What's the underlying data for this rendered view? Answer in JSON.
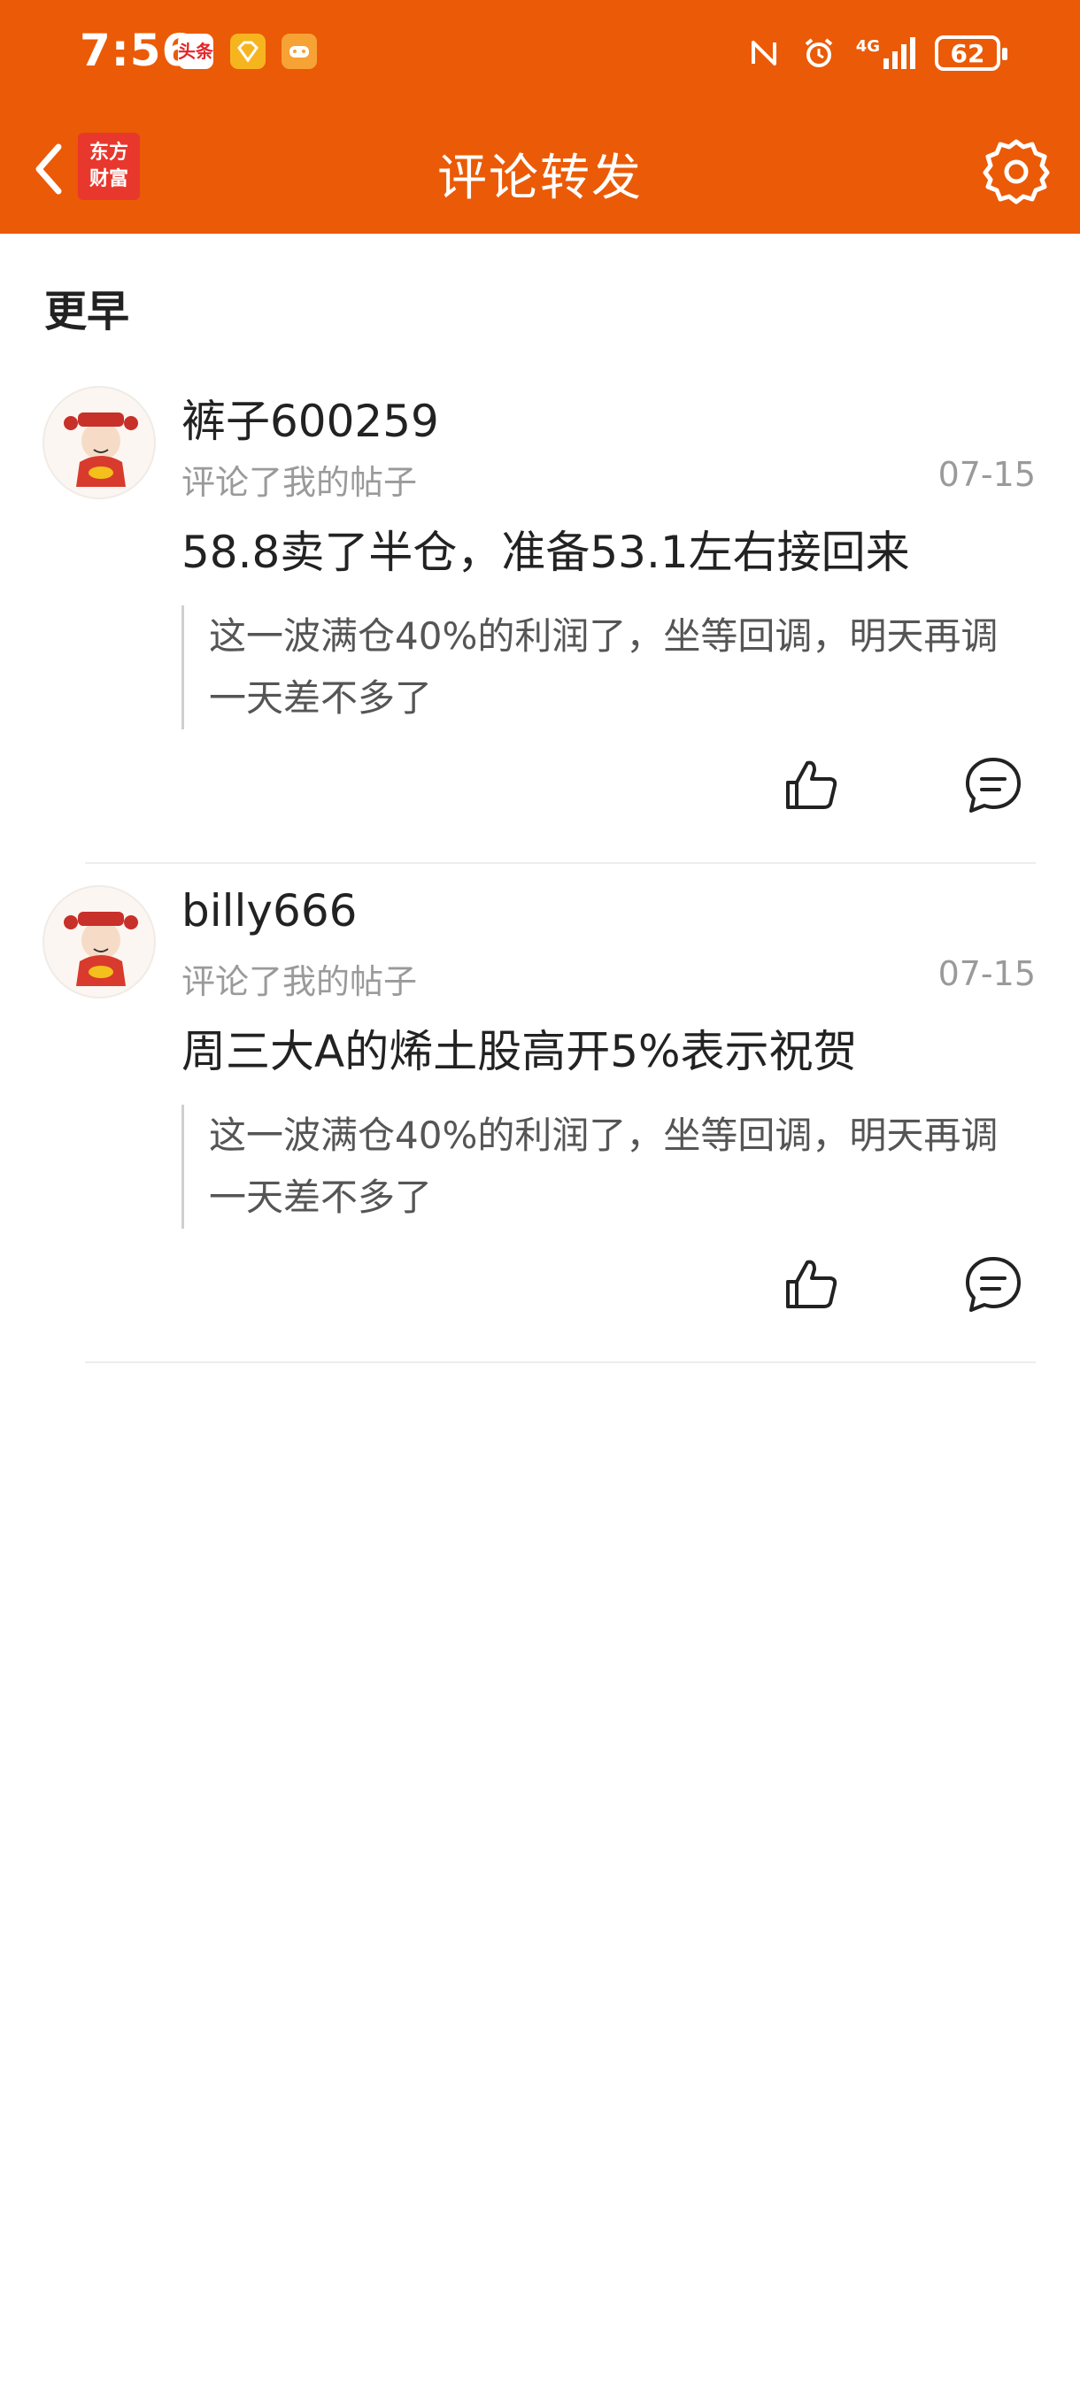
{
  "status": {
    "time": "7:56",
    "notif_badge_text": "头条",
    "network": "4G",
    "battery": "62"
  },
  "header": {
    "logo_line1": "东方",
    "logo_line2": "财富",
    "title": "评论转发"
  },
  "section": {
    "title": "更早"
  },
  "items": [
    {
      "username": "裤子600259",
      "action": "评论了我的帖子",
      "date": "07-15",
      "content": "58.8卖了半仓，准备53.1左右接回来",
      "quote": "这一波满仓40%的利润了，坐等回调，明天再调一天差不多了"
    },
    {
      "username": "billy666",
      "action": "评论了我的帖子",
      "date": "07-15",
      "content": "周三大A的烯土股高开5%表示祝贺",
      "quote": "这一波满仓40%的利润了，坐等回调，明天再调一天差不多了"
    }
  ],
  "colors": {
    "brand": "#eb5a06",
    "logo_red": "#e8372c"
  }
}
